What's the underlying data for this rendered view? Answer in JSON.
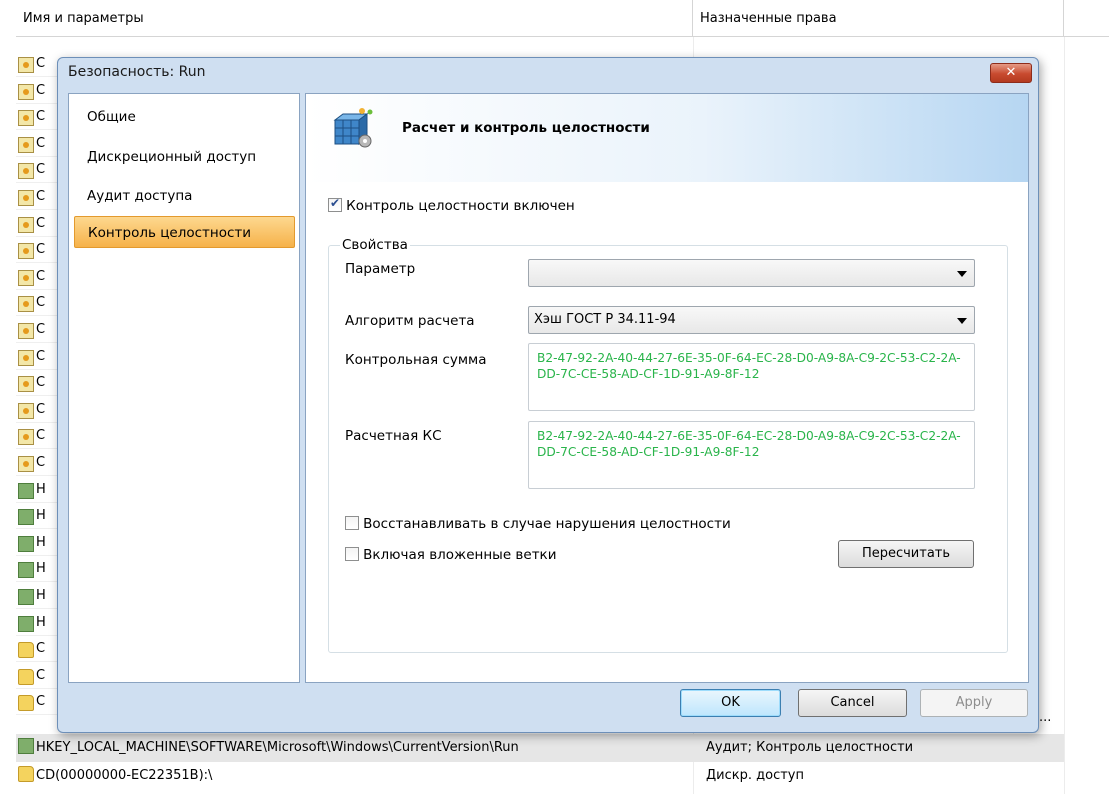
{
  "list": {
    "header": {
      "name_col": "Имя и параметры",
      "rights_col": "Назначенные права"
    },
    "rows": [
      {
        "icon": "file-icon",
        "label": "С"
      },
      {
        "icon": "file-icon",
        "label": "С"
      },
      {
        "icon": "file-icon",
        "label": "С"
      },
      {
        "icon": "file-icon",
        "label": "С"
      },
      {
        "icon": "file-icon",
        "label": "С"
      },
      {
        "icon": "file-icon",
        "label": "С"
      },
      {
        "icon": "file-icon",
        "label": "С"
      },
      {
        "icon": "file-icon",
        "label": "С"
      },
      {
        "icon": "file-icon",
        "label": "С"
      },
      {
        "icon": "file-icon",
        "label": "С"
      },
      {
        "icon": "file-icon",
        "label": "С"
      },
      {
        "icon": "file-icon",
        "label": "С"
      },
      {
        "icon": "file-icon",
        "label": "С"
      },
      {
        "icon": "file-icon",
        "label": "С"
      },
      {
        "icon": "file-icon",
        "label": "С"
      },
      {
        "icon": "file-icon",
        "label": "С"
      },
      {
        "icon": "registry-icon",
        "label": "Н"
      },
      {
        "icon": "registry-icon",
        "label": "Н"
      },
      {
        "icon": "registry-icon",
        "label": "Н"
      },
      {
        "icon": "registry-icon",
        "label": "Н"
      },
      {
        "icon": "registry-icon",
        "label": "Н"
      },
      {
        "icon": "registry-icon",
        "label": "Н"
      },
      {
        "icon": "folder-icon",
        "label": "С"
      },
      {
        "icon": "folder-icon",
        "label": "С"
      },
      {
        "icon": "folder-icon",
        "label": "С"
      }
    ],
    "ellipsis": "...",
    "selected_row": {
      "name": "HKEY_LOCAL_MACHINE\\SOFTWARE\\Microsoft\\Windows\\CurrentVersion\\Run",
      "rights": "Аудит; Контроль целостности"
    },
    "last_row": {
      "name": "CD(00000000-EC22351B):\\",
      "rights": "Дискр. доступ"
    }
  },
  "dialog": {
    "title": "Безопасность: Run",
    "close_label": "✕",
    "nav": [
      {
        "label": "Общие",
        "active": false
      },
      {
        "label": "Дискреционный доступ",
        "active": false
      },
      {
        "label": "Аудит доступа",
        "active": false
      },
      {
        "label": "Контроль целостности",
        "active": true
      }
    ],
    "header_title": "Расчет и контроль целостности",
    "integrity_enabled_label": "Контроль целостности включен",
    "integrity_enabled": true,
    "properties_legend": "Свойства",
    "param_label": "Параметр",
    "param_value": "",
    "algorithm_label": "Алгоритм расчета",
    "algorithm_value": "Хэш ГОСТ Р 34.11-94",
    "checksum_label": "Контрольная сумма",
    "checksum_value": "B2-47-92-2A-40-44-27-6E-35-0F-64-EC-28-D0-A9-8A-C9-2C-53-C2-2A-DD-7C-CE-58-AD-CF-1D-91-A9-8F-12",
    "computed_label": "Расчетная КС",
    "computed_value": "B2-47-92-2A-40-44-27-6E-35-0F-64-EC-28-D0-A9-8A-C9-2C-53-C2-2A-DD-7C-CE-58-AD-CF-1D-91-A9-8F-12",
    "restore_label": "Восстанавливать в случае нарушения целостности",
    "restore_checked": false,
    "include_nested_label": "Включая вложенные ветки",
    "include_nested_checked": false,
    "recalc_label": "Пересчитать",
    "ok_label": "OK",
    "cancel_label": "Cancel",
    "apply_label": "Apply"
  },
  "colors": {
    "hash_text": "#29b44a",
    "active_nav": "#f6b24a",
    "dialog_frame": "#cfdff1"
  }
}
